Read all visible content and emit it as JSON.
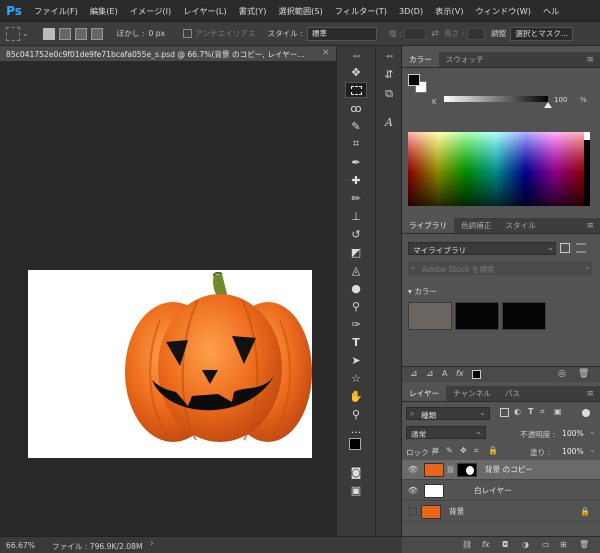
{
  "app": {
    "logo": "Ps"
  },
  "menu": [
    "ファイル(F)",
    "編集(E)",
    "イメージ(I)",
    "レイヤー(L)",
    "書式(Y)",
    "選択範囲(S)",
    "フィルター(T)",
    "3D(D)",
    "表示(V)",
    "ウィンドウ(W)",
    "ヘル"
  ],
  "options": {
    "feather_label": "ぼかし :",
    "feather_value": "0 px",
    "antialias_label": "アンチエイリアス",
    "style_label": "スタイル :",
    "style_value": "標準",
    "width_label": "幅 :",
    "height_label": "高さ :",
    "refine_label": "調整",
    "select_mask_label": "選択とマスク..."
  },
  "document": {
    "tab_title": "85c041752e0c9f01de9fe71bcafa055e_s.psd @ 66.7%(背景 のコピー, レイヤー...",
    "close": "×"
  },
  "status": {
    "zoom": "66.67%",
    "file": "ファイル : 796.9K/2.08M",
    "arrow": "›"
  },
  "color_panel": {
    "tabs": [
      "カラー",
      "スウォッチ"
    ],
    "slider_label": "K",
    "slider_value": "100",
    "slider_unit": "%",
    "slider_fraction": 1.0
  },
  "library_panel": {
    "tabs": [
      "ライブラリ",
      "色調補正",
      "スタイル"
    ],
    "library_name": "マイライブラリ",
    "search_placeholder": "Adobe Stock を検索",
    "section_label": "カラー",
    "swatches": [
      "#6b6661",
      "#050505",
      "#050505"
    ]
  },
  "layers_panel": {
    "tabs": [
      "レイヤー",
      "チャンネル",
      "パス"
    ],
    "filter_label": "種類",
    "blend_mode": "通常",
    "opacity_label": "不透明度 :",
    "opacity_value": "100%",
    "lock_label": "ロック :",
    "fill_label": "塗り :",
    "fill_value": "100%",
    "layers": [
      {
        "name": "背景 のコピー",
        "visible": true,
        "selected": true
      },
      {
        "name": "白レイヤー",
        "visible": true,
        "selected": false
      },
      {
        "name": "背景",
        "visible": false,
        "selected": false
      }
    ]
  },
  "colors": {
    "accent": "#31a8ff",
    "pumpkin": "#e8651c",
    "stem": "#6f8a2a"
  }
}
